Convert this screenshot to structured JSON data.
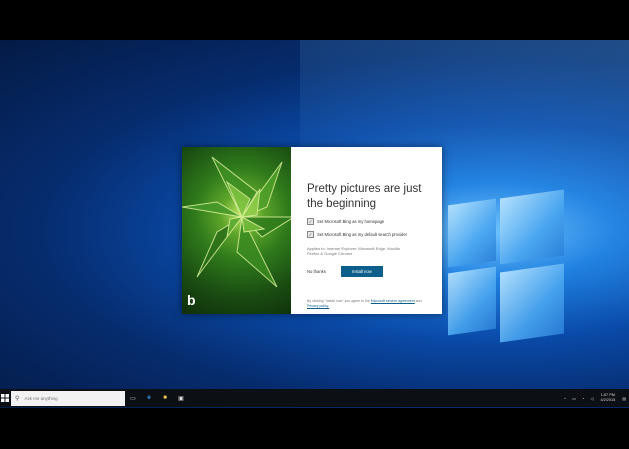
{
  "dialog": {
    "headline": "Pretty pictures are just the beginning",
    "checkbox_homepage": "Set Microsoft Bing as my homepage",
    "checkbox_search": "Set Microsoft Bing as my default search provider",
    "applies_to": "Applies to: Internet Explorer, Microsoft Edge, Mozilla Firefox & Google Chrome",
    "no_thanks": "No thanks",
    "install": "Install now",
    "legal_prefix": "By clicking \"Install now\" you agree to the",
    "legal_link1": "Microsoft service agreement",
    "legal_and": "and",
    "legal_link2": "Privacy policy.",
    "bing_logo": "b"
  },
  "taskbar": {
    "search_placeholder": "Ask me anything",
    "time": "1:57 PM",
    "date": "4/2/2015",
    "icons": [
      "start-icon",
      "task-view-icon",
      "edge-icon",
      "file-explorer-icon",
      "store-icon"
    ]
  }
}
